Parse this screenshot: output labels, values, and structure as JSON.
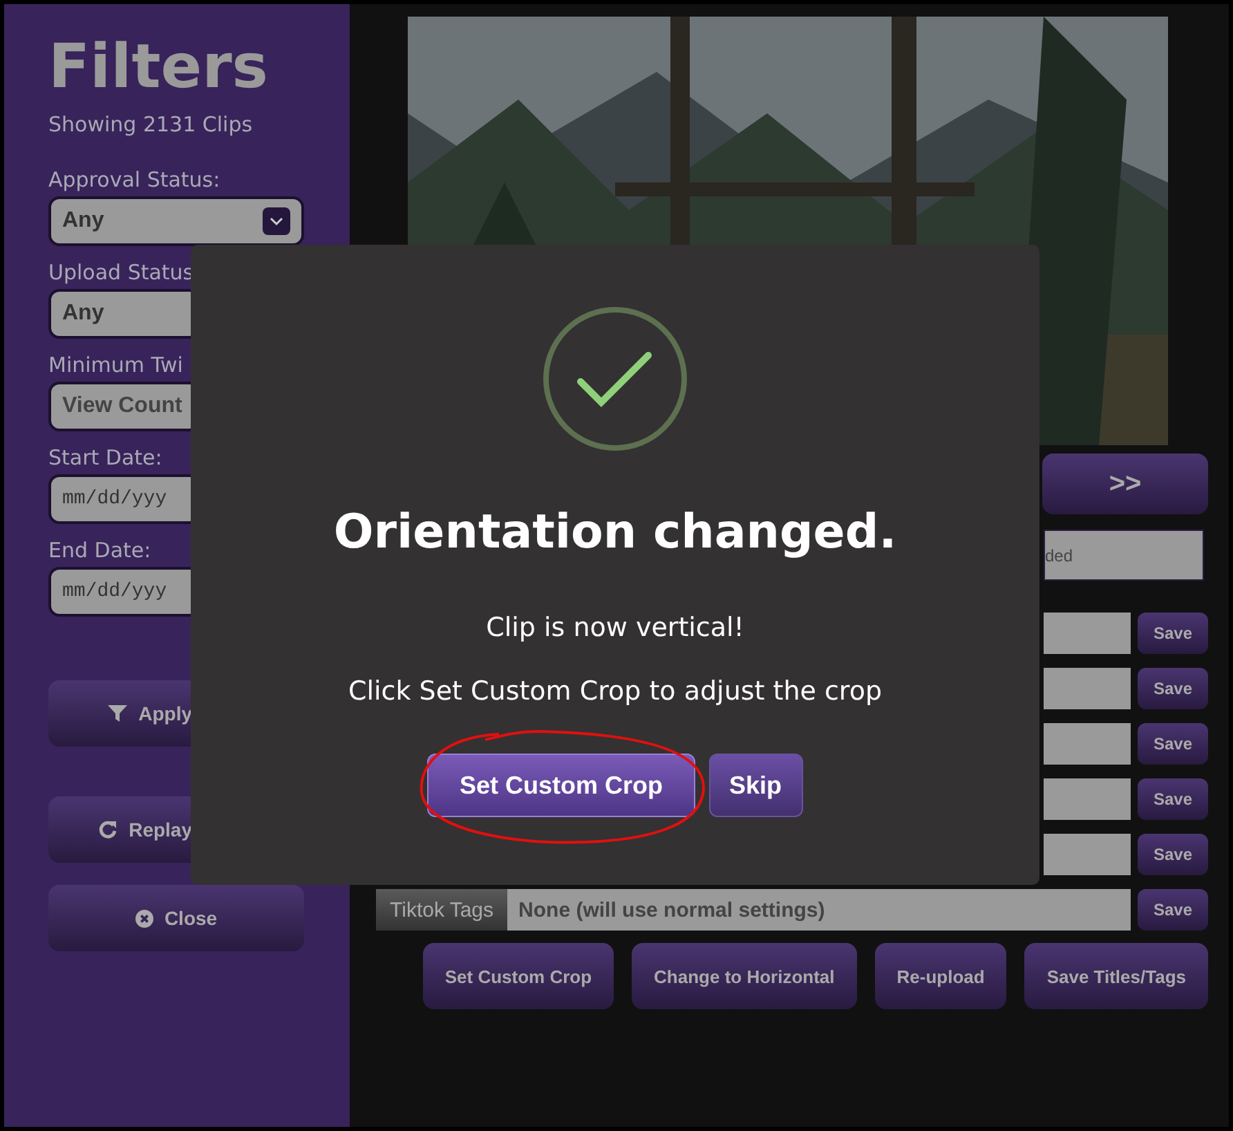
{
  "sidebar": {
    "title": "Filters",
    "subtitle": "Showing 2131 Clips",
    "fields": [
      {
        "label": "Approval Status:",
        "value": "Any",
        "kind": "select"
      },
      {
        "label": "Upload Status",
        "value": "Any",
        "kind": "select"
      },
      {
        "label": "Minimum Twi",
        "value": "View Count",
        "kind": "placeholder"
      },
      {
        "label": "Start Date:",
        "value": "mm/dd/yyy",
        "kind": "date"
      },
      {
        "label": "End Date:",
        "value": "mm/dd/yyy",
        "kind": "date"
      }
    ],
    "buttons": [
      {
        "label": "Apply",
        "kind": "filter"
      },
      {
        "label": "Replay",
        "kind": "redo"
      },
      {
        "label": "Close",
        "kind": "close"
      }
    ]
  },
  "main": {
    "next_button": ">>",
    "status_field": "ded",
    "rows": [
      {
        "save": "Save"
      },
      {
        "save": "Save"
      },
      {
        "save": "Save"
      },
      {
        "save": "Save"
      },
      {
        "save": "Save"
      },
      {
        "label": "Tiktok Tags",
        "value": "None (will use normal settings)",
        "save": "Save"
      }
    ],
    "actions": [
      "Set Custom Crop",
      "Change to Horizontal",
      "Re-upload",
      "Save Titles/Tags"
    ]
  },
  "dialog": {
    "title": "Orientation changed.",
    "message": "Clip is now vertical!",
    "hint": "Click Set Custom Crop to adjust the crop",
    "buttons": [
      {
        "label": "Set Custom Crop"
      },
      {
        "label": "Skip"
      }
    ]
  }
}
